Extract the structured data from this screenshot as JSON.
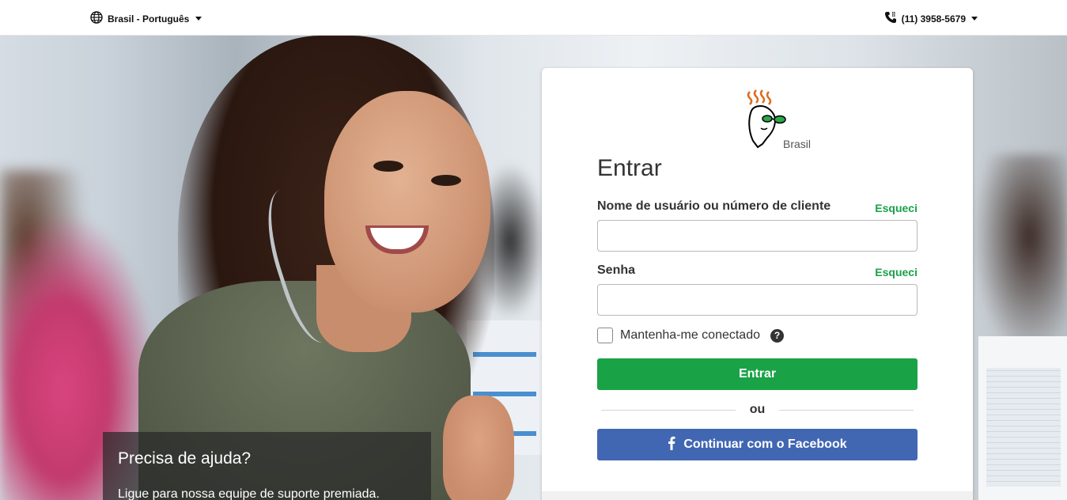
{
  "topbar": {
    "locale_label": "Brasil - Português",
    "phone_label": "(11) 3958-5679",
    "icons": {
      "locale": "globe-icon",
      "phone": "phone-icon",
      "caret": "chevron-down-icon"
    }
  },
  "hero": {
    "help_title": "Precisa de ajuda?",
    "help_text": "Ligue para nossa equipe de suporte premiada."
  },
  "login": {
    "logo_label": "Brasil",
    "title": "Entrar",
    "username_label": "Nome de usuário ou número de cliente",
    "username_forgot": "Esqueci",
    "username_value": "",
    "password_label": "Senha",
    "password_forgot": "Esqueci",
    "password_value": "",
    "remember_label": "Mantenha-me conectado",
    "remember_checked": false,
    "help_icon": "question-icon",
    "submit_label": "Entrar",
    "divider_label": "ou",
    "facebook_label": "Continuar com o Facebook",
    "facebook_icon": "facebook-icon"
  },
  "colors": {
    "primary_green": "#1aa246",
    "link_green": "#1ba04a",
    "facebook_blue": "#4267b2"
  }
}
